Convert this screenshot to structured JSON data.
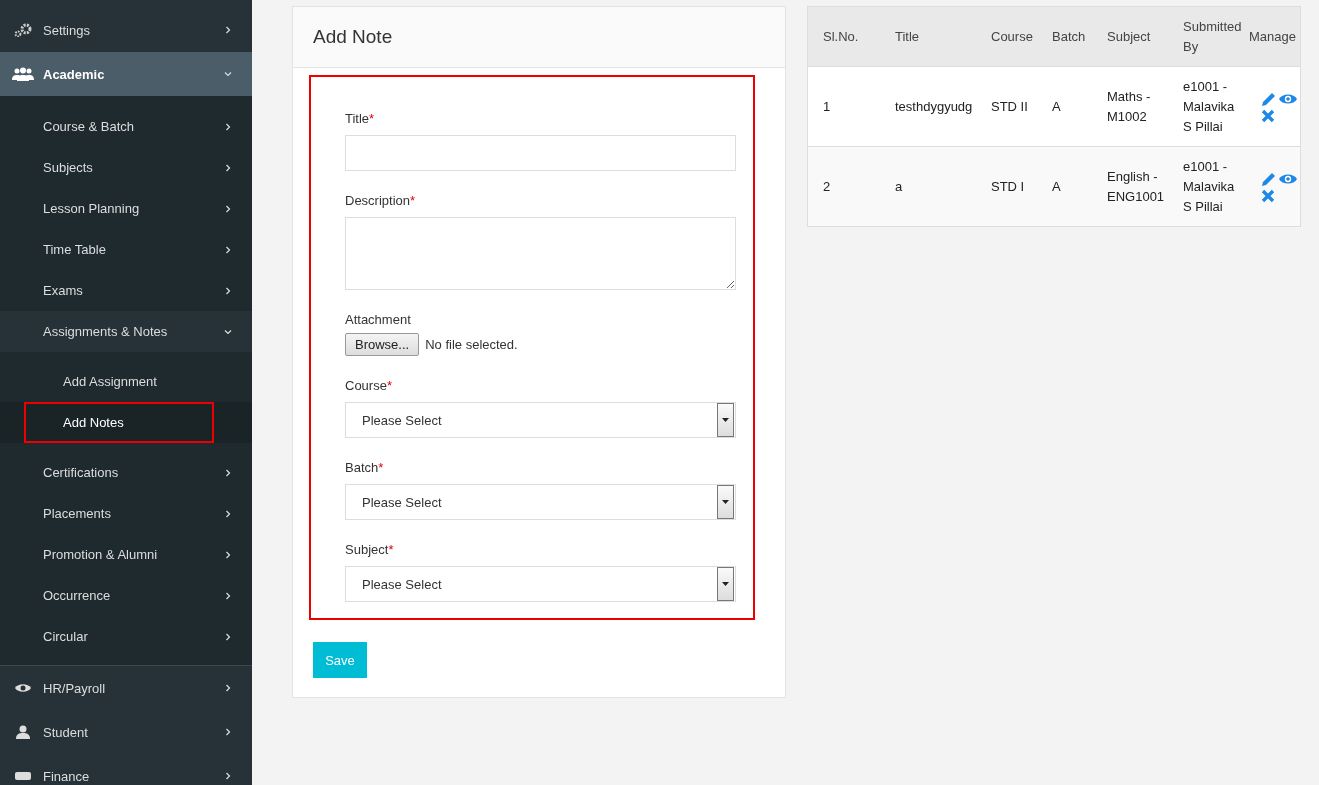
{
  "sidebar": {
    "items": [
      {
        "label": "Settings",
        "expanded": false,
        "selected": false
      },
      {
        "label": "Academic",
        "expanded": true,
        "selected": true,
        "children": [
          {
            "label": "Course & Batch",
            "expanded": false,
            "selected": false
          },
          {
            "label": "Subjects",
            "expanded": false,
            "selected": false
          },
          {
            "label": "Lesson Planning",
            "expanded": false,
            "selected": false
          },
          {
            "label": "Time Table",
            "expanded": false,
            "selected": false
          },
          {
            "label": "Exams",
            "expanded": false,
            "selected": false
          },
          {
            "label": "Assignments & Notes",
            "expanded": true,
            "selected": false,
            "children": [
              {
                "label": "Add Assignment",
                "selected": false,
                "annotated": false
              },
              {
                "label": "Add Notes",
                "selected": true,
                "annotated": true
              }
            ]
          },
          {
            "label": "Certifications",
            "expanded": false,
            "selected": false
          },
          {
            "label": "Placements",
            "expanded": false,
            "selected": false
          },
          {
            "label": "Promotion & Alumni",
            "expanded": false,
            "selected": false
          },
          {
            "label": "Occurrence",
            "expanded": false,
            "selected": false
          },
          {
            "label": "Circular",
            "expanded": false,
            "selected": false
          }
        ]
      },
      {
        "label": "HR/Payroll",
        "expanded": false,
        "selected": false
      },
      {
        "label": "Student",
        "expanded": false,
        "selected": false
      },
      {
        "label": "Finance",
        "expanded": false,
        "selected": false
      }
    ]
  },
  "form": {
    "title": "Add Note",
    "annotated": true,
    "fields": [
      {
        "kind": "text",
        "label": "Title",
        "required": true
      },
      {
        "kind": "textarea",
        "label": "Description",
        "required": true
      },
      {
        "kind": "file",
        "label": "Attachment",
        "required": false,
        "button": "Browse...",
        "status": "No file selected."
      },
      {
        "kind": "select",
        "label": "Course",
        "required": true,
        "value": "Please Select"
      },
      {
        "kind": "select",
        "label": "Batch",
        "required": true,
        "value": "Please Select"
      },
      {
        "kind": "select",
        "label": "Subject",
        "required": true,
        "value": "Please Select"
      }
    ],
    "required_mark": "*",
    "submit": "Save"
  },
  "table": {
    "columns": [
      "Sl.No.",
      "Title",
      "Course",
      "Batch",
      "Subject",
      "Submitted By",
      "Manage"
    ],
    "rows": [
      {
        "cells": [
          "1",
          "testhdygyudg",
          "STD II",
          "A",
          "Maths - M1002",
          "e1001 - Malavika S Pillai"
        ]
      },
      {
        "cells": [
          "2",
          "a",
          "STD I",
          "A",
          "English - ENG1001",
          "e1001 - Malavika S Pillai"
        ]
      }
    ]
  }
}
